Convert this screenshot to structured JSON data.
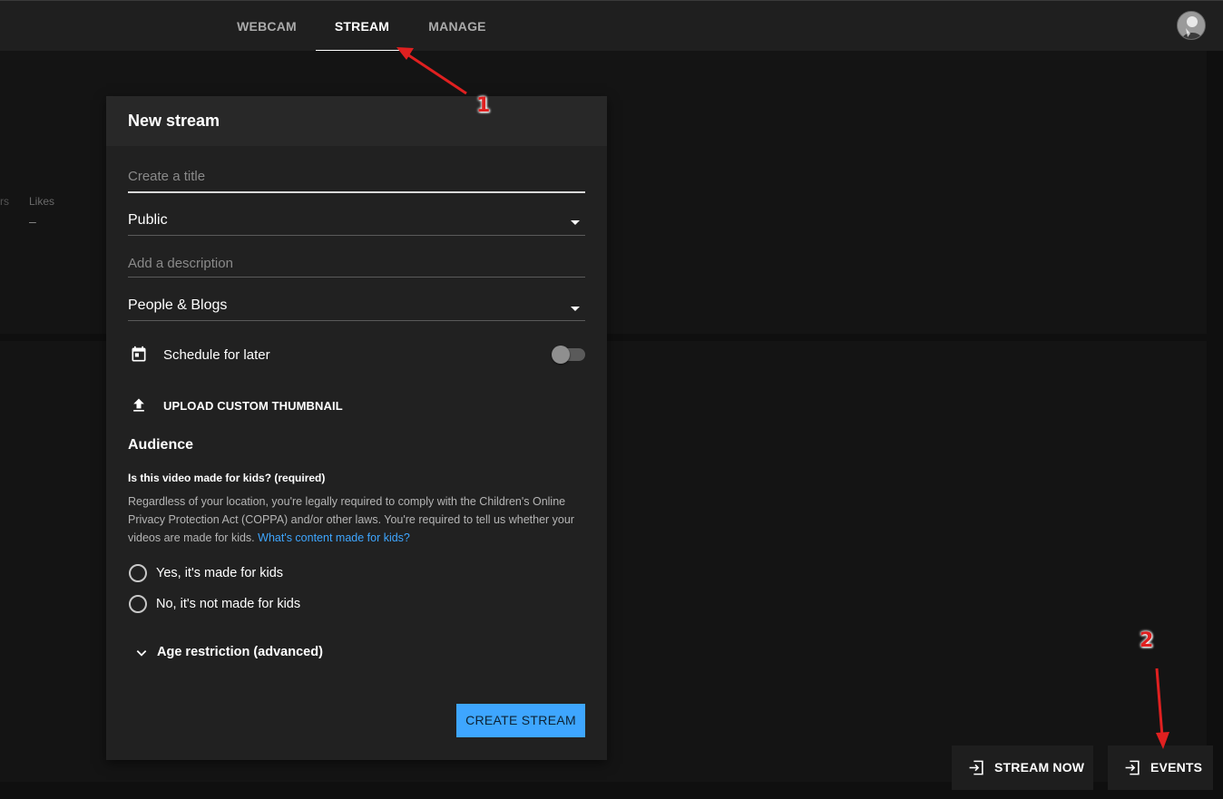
{
  "topbar": {
    "tabs": [
      {
        "label": "WEBCAM",
        "active": false
      },
      {
        "label": "STREAM",
        "active": true
      },
      {
        "label": "MANAGE",
        "active": false
      }
    ]
  },
  "background": {
    "likes_label": "Likes",
    "likes_value": "–",
    "partial_label": "rs"
  },
  "dialog": {
    "title": "New stream",
    "title_placeholder": "Create a title",
    "visibility_value": "Public",
    "description_placeholder": "Add a description",
    "category_value": "People & Blogs",
    "schedule_label": "Schedule for later",
    "schedule_enabled": false,
    "upload_label": "UPLOAD CUSTOM THUMBNAIL",
    "audience": {
      "title": "Audience",
      "question": "Is this video made for kids? (required)",
      "paragraph": "Regardless of your location, you're legally required to comply with the Children's Online Privacy Protection Act (COPPA) and/or other laws. You're required to tell us whether your videos are made for kids.",
      "link": "What's content made for kids?",
      "options": [
        "Yes, it's made for kids",
        "No, it's not made for kids"
      ]
    },
    "age_restriction_label": "Age restriction (advanced)",
    "create_button": "CREATE STREAM"
  },
  "actions": {
    "stream_now": "STREAM NOW",
    "events": "EVENTS"
  },
  "annotations": {
    "badge_1": "1",
    "badge_2": "2",
    "arrow_color": "#e02020"
  },
  "colors": {
    "accent": "#3ea6ff",
    "background": "#0f0f0f",
    "dialog": "#212121"
  },
  "icons": [
    "calendar-icon",
    "upload-icon",
    "chevron-down-icon",
    "dropdown-caret-icon",
    "enter-icon"
  ]
}
